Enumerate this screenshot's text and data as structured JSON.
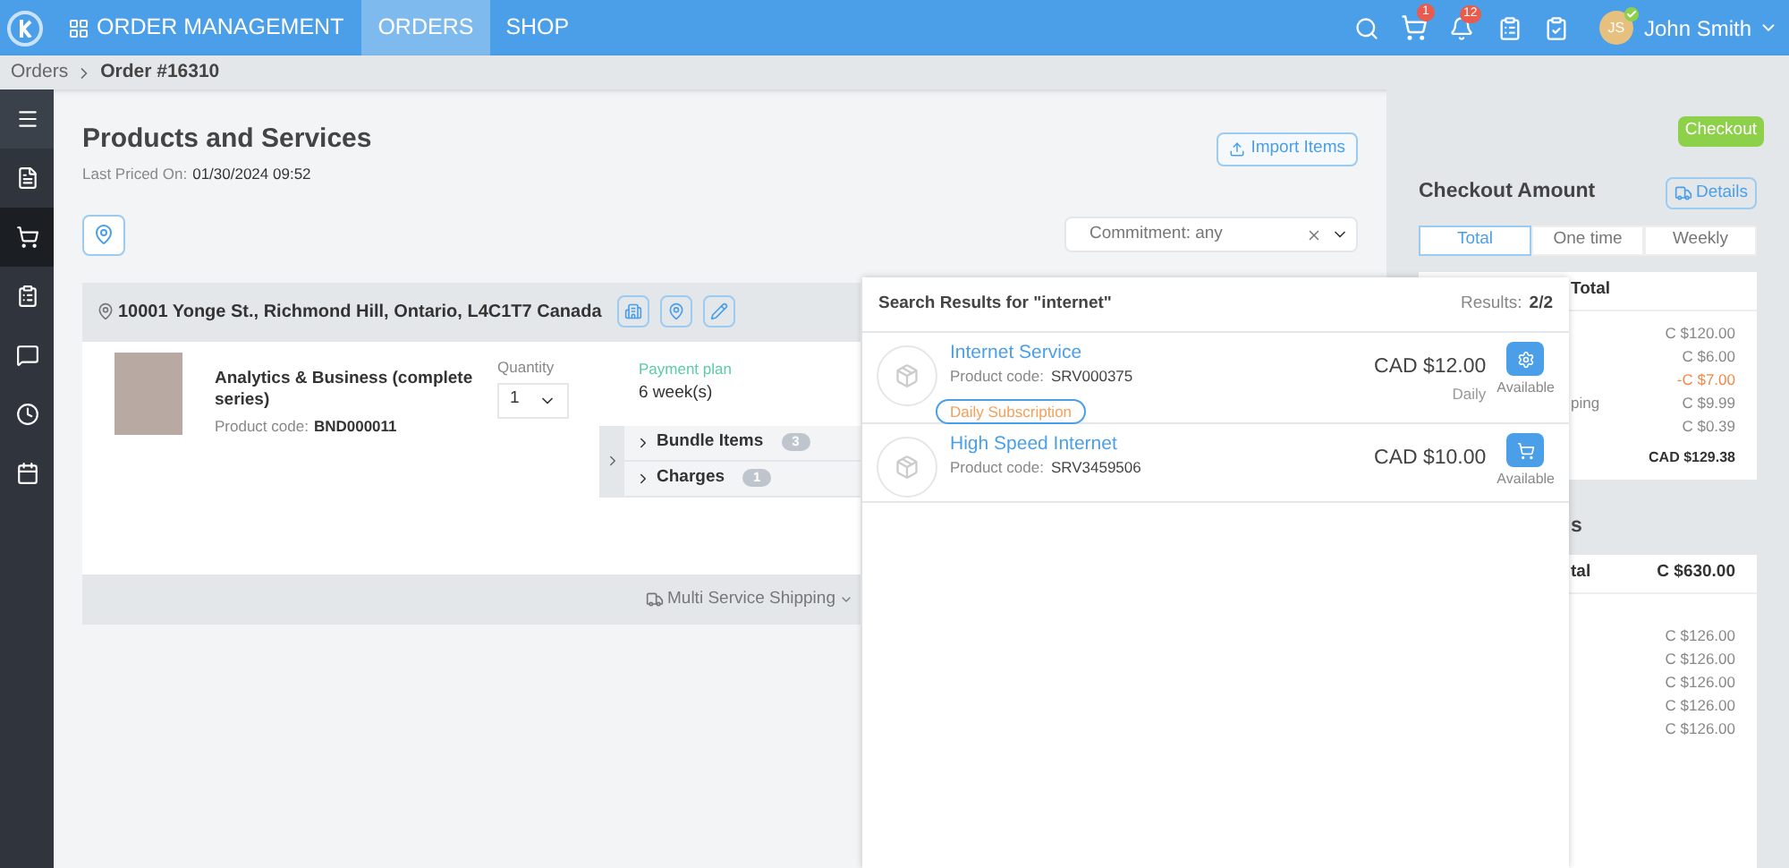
{
  "topbar": {
    "app_title": "ORDER MANAGEMENT",
    "nav": [
      {
        "label": "ORDERS",
        "selected": true
      },
      {
        "label": "SHOP",
        "selected": false
      }
    ],
    "cart_badge": "1",
    "notifications_badge": "12",
    "user": {
      "initials": "JS",
      "name": "John Smith",
      "online": true
    }
  },
  "breadcrumb": [
    "Orders",
    "Order #16310"
  ],
  "sidebar": {
    "items": [
      {
        "selected": false
      },
      {
        "selected": false
      },
      {
        "selected": true
      },
      {
        "selected": false
      },
      {
        "selected": false
      },
      {
        "selected": false
      },
      {
        "selected": false
      }
    ]
  },
  "main": {
    "title": "Products and Services",
    "last_priced_label": "Last Priced On:",
    "last_priced_value": "01/30/2024 09:52",
    "import_button": "Import Items",
    "commitment_filter": "Commitment: any",
    "location": {
      "address": "10001 Yonge St., Richmond Hill, Ontario, L4C1T7 Canada",
      "product": {
        "name": "Analytics & Business (complete series)",
        "code_label": "Product code:",
        "code": "BND000011",
        "quantity_label": "Quantity",
        "quantity": "1",
        "plan_label": "Payment plan",
        "plan": "6 week(s)"
      },
      "sections": [
        {
          "label": "Bundle Items",
          "count": "3"
        },
        {
          "label": "Charges",
          "count": "1"
        }
      ],
      "shipping": "Multi Service Shipping"
    }
  },
  "search_results": {
    "title": "Search Results for \"internet\"",
    "count_label": "Results:",
    "count": "2/2",
    "items": [
      {
        "name": "Internet Service",
        "code_label": "Product code:",
        "code": "SRV000375",
        "tag": "Daily Subscription",
        "price": "CAD $12.00",
        "period": "Daily",
        "kind": "configure",
        "availability": "Available"
      },
      {
        "name": "High Speed Internet",
        "code_label": "Product code:",
        "code": "SRV3459506",
        "price": "CAD $10.00",
        "kind": "cart",
        "availability": "Available"
      }
    ]
  },
  "checkout": {
    "button": "Checkout",
    "title": "Checkout Amount",
    "details_button": "Details",
    "tabs": [
      {
        "label": "Total",
        "selected": true
      },
      {
        "label": "One time",
        "selected": false
      },
      {
        "label": "Weekly",
        "selected": false
      }
    ],
    "summary": {
      "header": "Total",
      "rows": [
        {
          "value": "C $120.00",
          "kind": "amount"
        },
        {
          "value": "C $6.00",
          "kind": "amount"
        },
        {
          "value": "-C $7.00",
          "kind": "discount"
        },
        {
          "label": "ping",
          "value": "C $9.99",
          "kind": "amount"
        },
        {
          "value": "C $0.39",
          "kind": "amount"
        }
      ],
      "total": "CAD $129.38"
    },
    "second": {
      "heading": "s",
      "header_label": "tal",
      "header_value": "C $630.00",
      "rows": [
        "C $126.00",
        "C $126.00",
        "C $126.00",
        "C $126.00",
        "C $126.00"
      ]
    }
  }
}
